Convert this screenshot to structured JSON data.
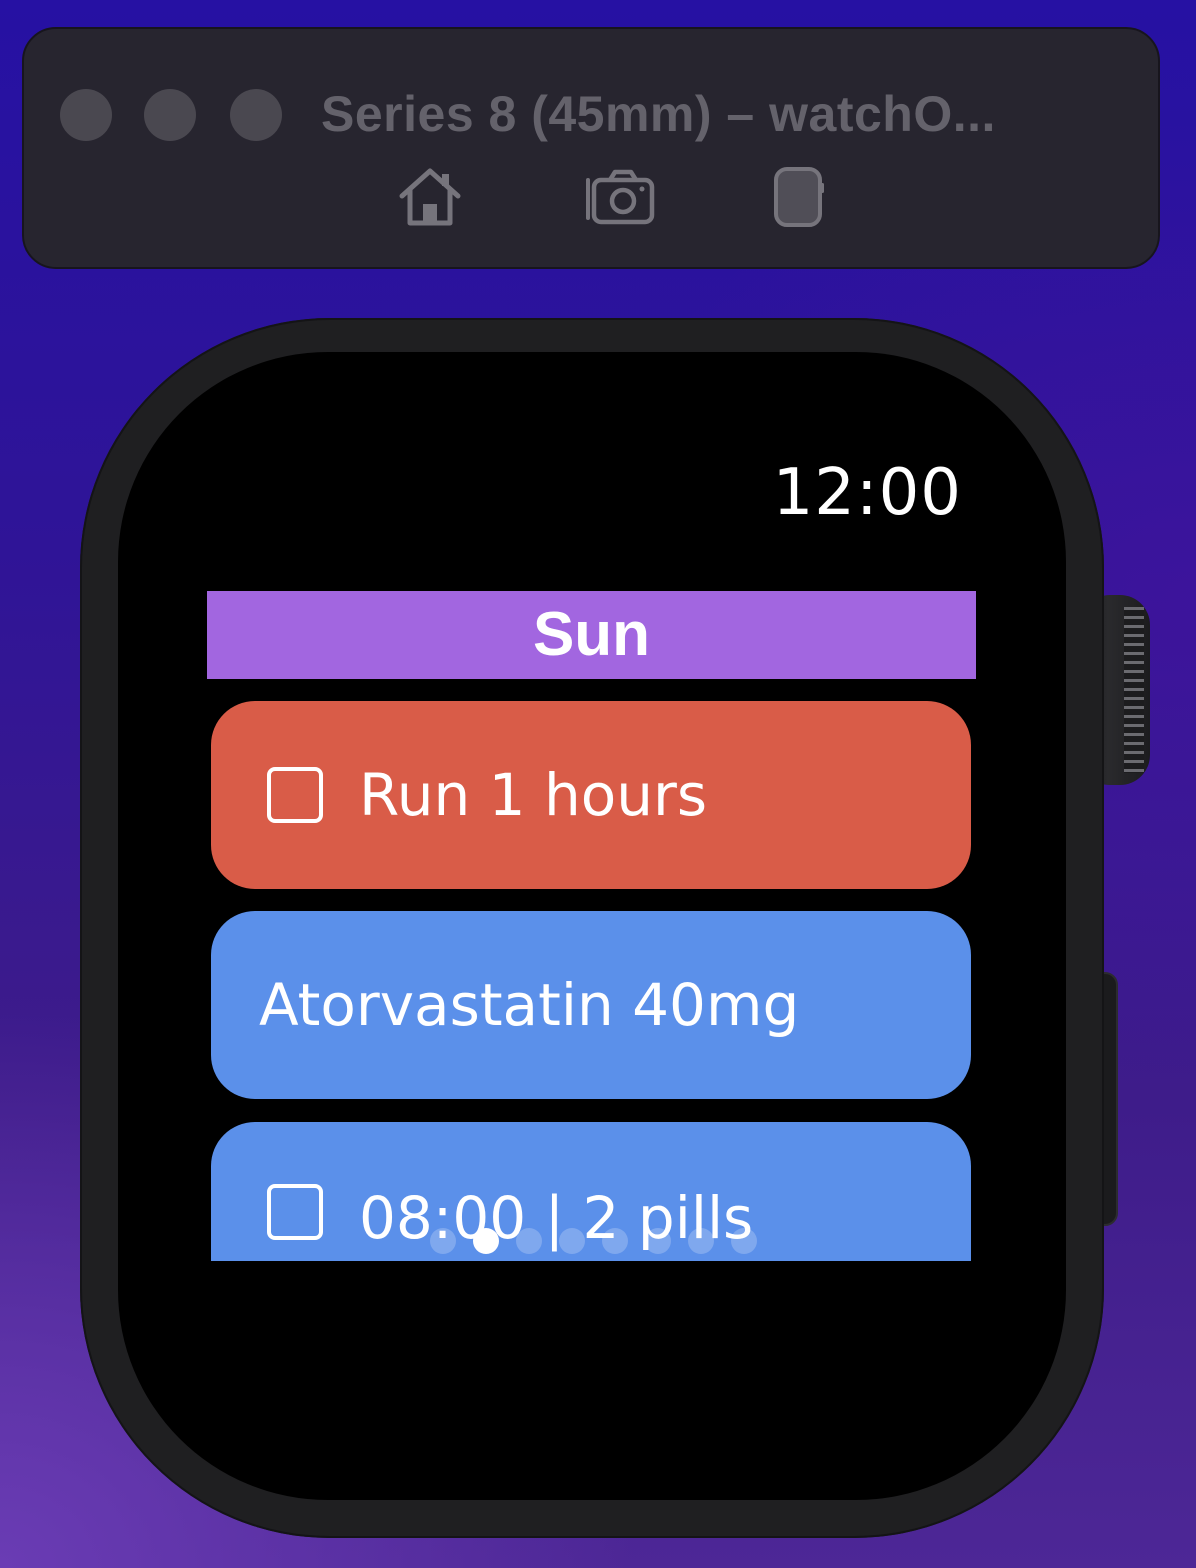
{
  "window": {
    "title": "Series 8 (45mm) – watchO...",
    "toolbar": [
      {
        "icon": "home-icon",
        "label": "Home"
      },
      {
        "icon": "camera-icon",
        "label": "Screenshot"
      },
      {
        "icon": "rotate-device-icon",
        "label": "Rotate"
      }
    ]
  },
  "watch": {
    "time": "12:00",
    "day_header": "Sun",
    "header_color": "#a266e0",
    "items": [
      {
        "text": "Run 1 hours",
        "checkbox": true,
        "checked": false,
        "color": "#d95c48"
      },
      {
        "text": "Atorvastatin 40mg",
        "checkbox": false,
        "color": "#5b90ea"
      },
      {
        "text": "08:00 | 2 pills",
        "checkbox": true,
        "checked": false,
        "color": "#5b90ea"
      }
    ],
    "page_indicator": {
      "total": 8,
      "current": 2
    }
  }
}
